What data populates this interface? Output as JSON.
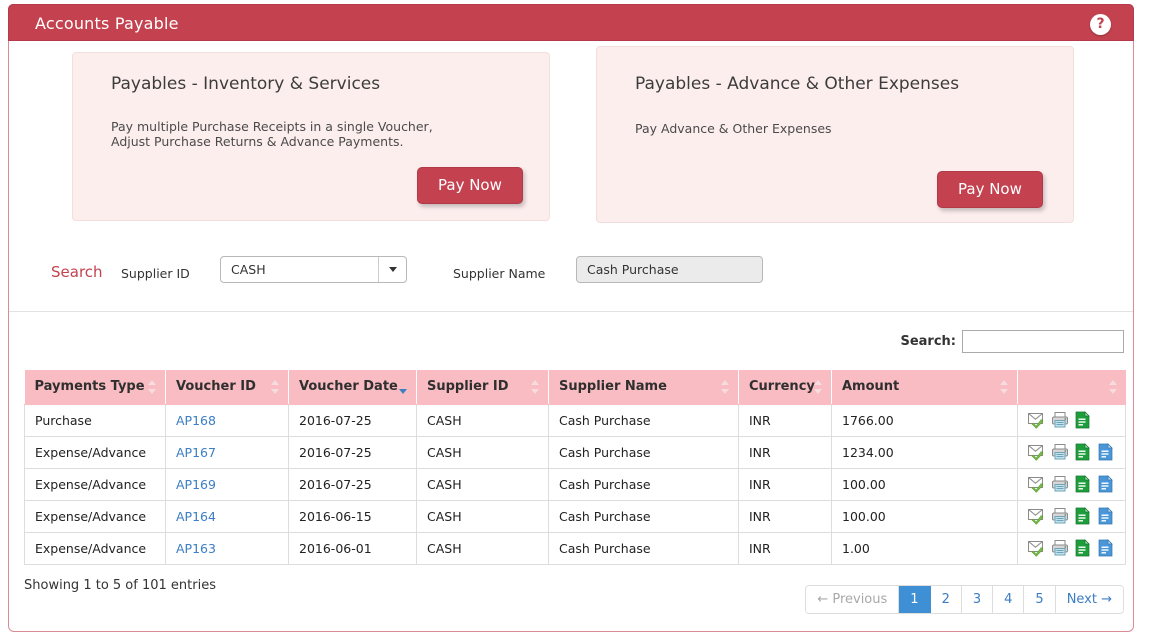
{
  "window": {
    "title": "Accounts Payable",
    "help_icon": "question-mark-icon",
    "header_color": "#c4424f"
  },
  "cards": [
    {
      "title": "Payables - Inventory & Services",
      "description": "Pay multiple Purchase Receipts in a single Voucher,\nAdjust Purchase Returns & Advance Payments.",
      "button_label": "Pay Now"
    },
    {
      "title": "Payables - Advance & Other Expenses",
      "description": "Pay Advance & Other Expenses",
      "button_label": "Pay Now"
    }
  ],
  "filter": {
    "search_label": "Search",
    "supplier_id_label": "Supplier ID",
    "supplier_id_value": "CASH",
    "supplier_name_label": "Supplier Name",
    "supplier_name_value": "Cash Purchase"
  },
  "datatable": {
    "search_label": "Search:",
    "search_value": "",
    "search_placeholder": "",
    "columns": [
      {
        "label": "Payments Type",
        "sort": "none"
      },
      {
        "label": "Voucher ID",
        "sort": "none"
      },
      {
        "label": "Voucher Date",
        "sort": "desc"
      },
      {
        "label": "Supplier ID",
        "sort": "none"
      },
      {
        "label": "Supplier Name",
        "sort": "none"
      },
      {
        "label": "Currency",
        "sort": "none"
      },
      {
        "label": "Amount",
        "sort": "none"
      },
      {
        "label": "",
        "sort": "none"
      }
    ],
    "rows": [
      {
        "payments_type": "Purchase",
        "voucher_id": "AP168",
        "voucher_date": "2016-07-25",
        "supplier_id": "CASH",
        "supplier_name": "Cash Purchase",
        "currency": "INR",
        "amount": "1766.00",
        "actions": [
          "email-approved-icon",
          "print-icon",
          "green-document-icon"
        ]
      },
      {
        "payments_type": "Expense/Advance",
        "voucher_id": "AP167",
        "voucher_date": "2016-07-25",
        "supplier_id": "CASH",
        "supplier_name": "Cash Purchase",
        "currency": "INR",
        "amount": "1234.00",
        "actions": [
          "email-approved-icon",
          "print-icon",
          "green-document-icon",
          "blue-document-icon"
        ]
      },
      {
        "payments_type": "Expense/Advance",
        "voucher_id": "AP169",
        "voucher_date": "2016-07-25",
        "supplier_id": "CASH",
        "supplier_name": "Cash Purchase",
        "currency": "INR",
        "amount": "100.00",
        "actions": [
          "email-approved-icon",
          "print-icon",
          "green-document-icon",
          "blue-document-icon"
        ]
      },
      {
        "payments_type": "Expense/Advance",
        "voucher_id": "AP164",
        "voucher_date": "2016-06-15",
        "supplier_id": "CASH",
        "supplier_name": "Cash Purchase",
        "currency": "INR",
        "amount": "100.00",
        "actions": [
          "email-approved-icon",
          "print-icon",
          "green-document-icon",
          "blue-document-icon"
        ]
      },
      {
        "payments_type": "Expense/Advance",
        "voucher_id": "AP163",
        "voucher_date": "2016-06-01",
        "supplier_id": "CASH",
        "supplier_name": "Cash Purchase",
        "currency": "INR",
        "amount": "1.00",
        "actions": [
          "email-approved-icon",
          "print-icon",
          "green-document-icon",
          "blue-document-icon"
        ]
      }
    ],
    "info": "Showing 1 to 5 of 101 entries",
    "pagination": {
      "previous": "← Previous",
      "pages": [
        "1",
        "2",
        "3",
        "4",
        "5"
      ],
      "next": "Next →",
      "active_page": "1",
      "active_color": "#3e8fd4"
    }
  }
}
